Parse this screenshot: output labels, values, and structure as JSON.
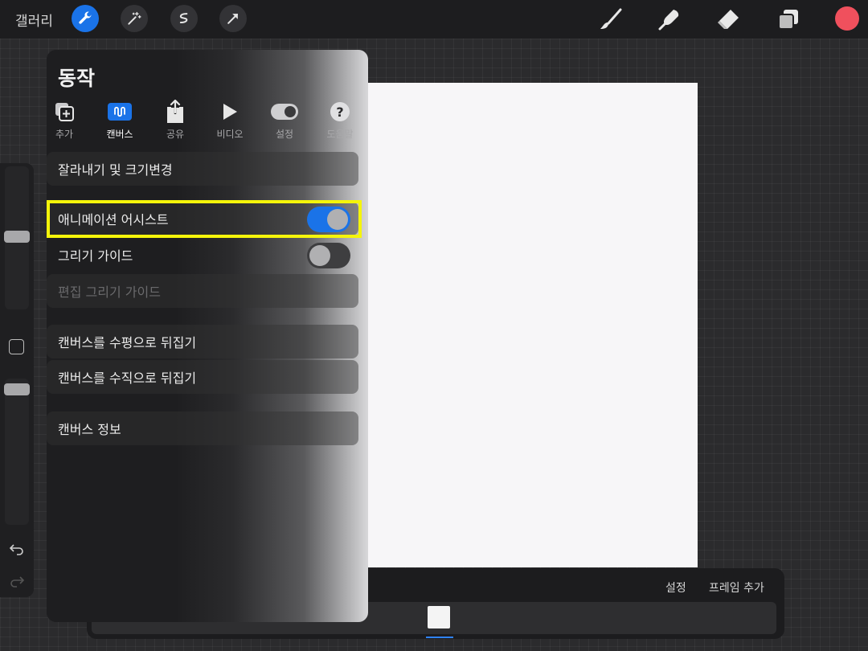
{
  "topbar": {
    "gallery_label": "갤러리",
    "tools": [
      {
        "name": "wrench-icon",
        "active": true
      },
      {
        "name": "magic-wand-icon",
        "active": false
      },
      {
        "name": "selection-icon",
        "active": false
      },
      {
        "name": "transform-arrow-icon",
        "active": false
      }
    ],
    "right_tools": [
      "brush-icon",
      "smudge-icon",
      "eraser-icon",
      "layers-icon"
    ],
    "current_color": "#f0505d"
  },
  "panel": {
    "title": "동작",
    "tabs": [
      {
        "label": "추가",
        "icon": "add-icon",
        "active": false
      },
      {
        "label": "캔버스",
        "icon": "canvas-icon",
        "active": true
      },
      {
        "label": "공유",
        "icon": "share-icon",
        "active": false
      },
      {
        "label": "비디오",
        "icon": "play-icon",
        "active": false
      },
      {
        "label": "설정",
        "icon": "settings-toggle-icon",
        "active": false
      },
      {
        "label": "도움말",
        "icon": "help-icon",
        "active": false
      }
    ],
    "items": {
      "crop_resize": "잘라내기 및 크기변경",
      "animation_assist": "애니메이션 어시스트",
      "drawing_guide": "그리기 가이드",
      "edit_drawing_guide": "편집 그리기 가이드",
      "flip_horizontal": "캔버스를 수평으로 뒤집기",
      "flip_vertical": "캔버스를 수직으로 뒤집기",
      "canvas_info": "캔버스 정보"
    },
    "toggles": {
      "animation_assist_on": true,
      "drawing_guide_on": false
    }
  },
  "anim_panel": {
    "settings_label": "설정",
    "add_frame_label": "프레임 추가"
  },
  "colors": {
    "accent": "#1a73e8",
    "highlight": "#f5f50a",
    "canvas": "#f7f6f8"
  }
}
